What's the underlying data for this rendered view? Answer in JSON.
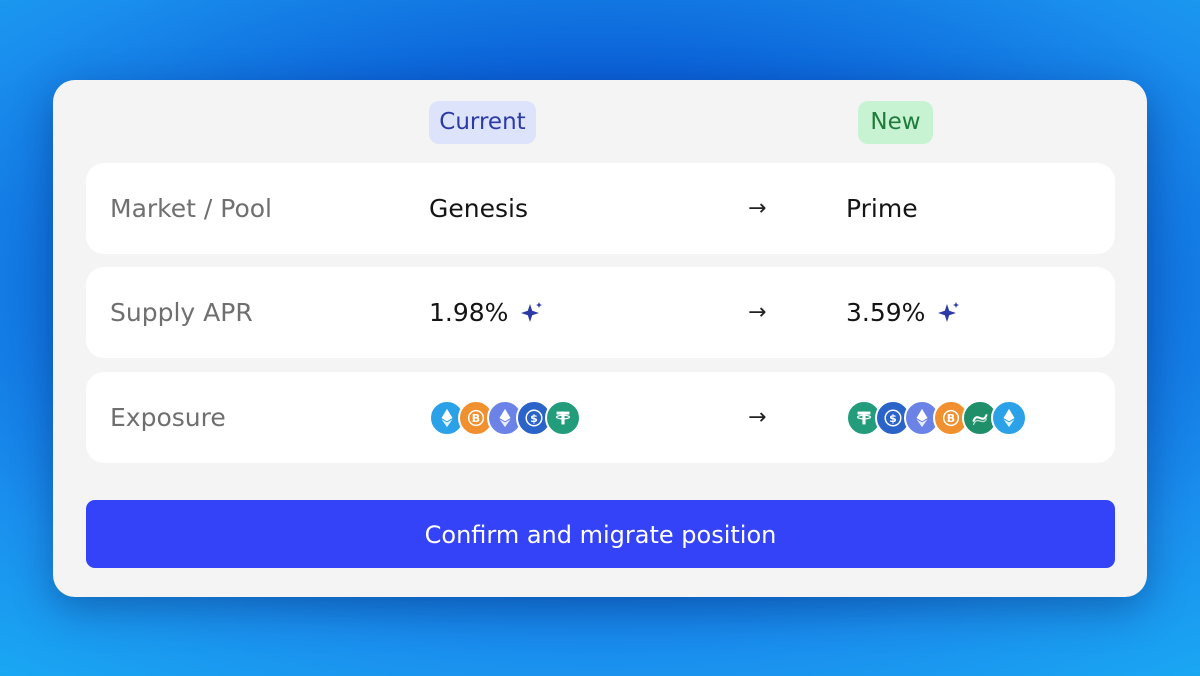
{
  "header": {
    "current_label": "Current",
    "new_label": "New"
  },
  "rows": [
    {
      "label": "Market / Pool",
      "current": "Genesis",
      "new": "Prime"
    },
    {
      "label": "Supply APR",
      "current": "1.98%",
      "new": "3.59%"
    },
    {
      "label": "Exposure"
    }
  ],
  "arrow": "→",
  "exposure": {
    "current": [
      {
        "name": "eth-staked-token-icon",
        "color": "#2ba1e8",
        "glyph": "eth"
      },
      {
        "name": "btc-token-icon",
        "color": "#f0902f",
        "glyph": "btc"
      },
      {
        "name": "eth-token-icon",
        "color": "#6b83e6",
        "glyph": "eth"
      },
      {
        "name": "usdc-token-icon",
        "color": "#2b64c8",
        "glyph": "usd"
      },
      {
        "name": "usdt-token-icon",
        "color": "#239c7c",
        "glyph": "tether"
      }
    ],
    "new": [
      {
        "name": "usdt-token-icon",
        "color": "#239c7c",
        "glyph": "tether"
      },
      {
        "name": "usdc-token-icon",
        "color": "#2b64c8",
        "glyph": "usd"
      },
      {
        "name": "eth-token-icon",
        "color": "#6b83e6",
        "glyph": "eth"
      },
      {
        "name": "btc-token-icon",
        "color": "#f0902f",
        "glyph": "btc"
      },
      {
        "name": "stable-swirl-token-icon",
        "color": "#1f8f6a",
        "glyph": "swirl"
      },
      {
        "name": "eth-staked-token-icon",
        "color": "#2ba1e8",
        "glyph": "eth"
      }
    ]
  },
  "cta": {
    "label": "Confirm and migrate position"
  },
  "colors": {
    "accent": "#3442f8",
    "sparkle": "#2c3aa8",
    "current_pill": "#dce3fb",
    "new_pill": "#c8f3d2"
  }
}
